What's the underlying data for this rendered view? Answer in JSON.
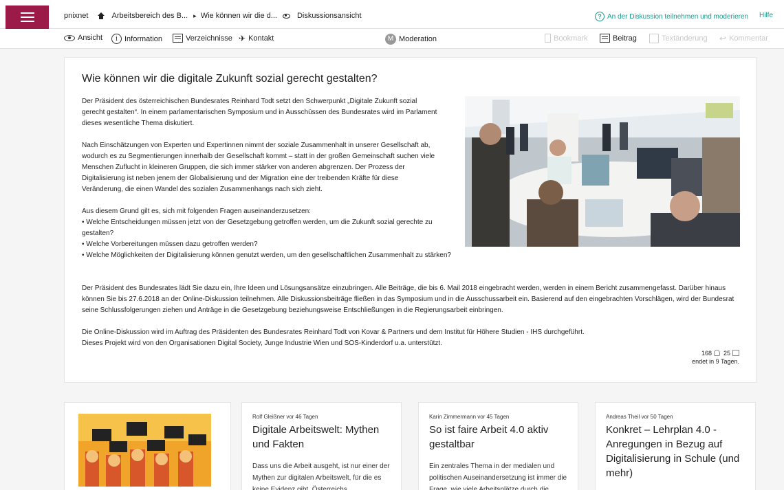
{
  "nav": {
    "site": "pnixnet",
    "crumb1": "Arbeitsbereich des B...",
    "crumb2": "Wie können wir die d...",
    "crumb3": "Diskussionsansicht",
    "join": "An der Diskussion teilnehmen und moderieren",
    "help": "Hilfe"
  },
  "toolbar": {
    "ansicht": "Ansicht",
    "information": "Information",
    "verzeichnisse": "Verzeichnisse",
    "kontakt": "Kontakt",
    "moderation": "Moderation",
    "bookmark": "Bookmark",
    "beitrag": "Beitrag",
    "textaenderung": "Textänderung",
    "kommentar": "Kommentar"
  },
  "article": {
    "title": "Wie können wir die digitale Zukunft sozial gerecht gestalten?",
    "p1": "Der Präsident des österreichischen Bundesrates Reinhard Todt setzt den Schwerpunkt „Digitale Zukunft sozial gerecht gestalten“. In einem parlamentarischen Symposium und in Ausschüssen des Bundesrates wird im Parlament dieses wesentliche Thema diskutiert.",
    "p2": "Nach Einschätzungen von Experten und Expertinnen nimmt der soziale Zusammenhalt in unserer Gesellschaft ab, wodurch es zu Segmentierungen innerhalb der Gesellschaft kommt – statt in der großen Gemeinschaft suchen viele Menschen Zuflucht in kleineren Gruppen, die sich immer stärker von anderen abgrenzen. Der Prozess der Digitalisierung ist neben jenem der Globalisierung und der Migration eine der treibenden Kräfte für diese Veränderung, die einen Wandel des sozialen Zusammenhangs nach sich zieht.",
    "p3_intro": "Aus diesem Grund gilt es, sich mit folgenden Fragen auseinanderzusetzen:",
    "q1": "• Welche Entscheidungen müssen jetzt von der Gesetzgebung getroffen werden, um die Zukunft sozial gerechte zu gestalten?",
    "q2": "• Welche Vorbereitungen müssen dazu getroffen werden?",
    "q3": "• Welche Möglichkeiten der Digitalisierung können genutzt werden, um den gesellschaftlichen Zusammenhalt zu stärken?",
    "p4": "Der Präsident des Bundesrates lädt Sie dazu ein, Ihre Ideen und Lösungsansätze einzubringen. Alle Beiträge, die bis 6. Mail 2018 eingebracht werden, werden in einem Bericht zusammengefasst. Darüber hinaus können Sie bis 27.6.2018 an der Online-Diskussion teilnehmen. Alle Diskussionsbeiträge fließen in das Symposium und in die Ausschussarbeit ein. Basierend auf den eingebrachten Vorschlägen, wird der Bundesrat seine Schlussfolgerungen ziehen und Anträge in die Gesetzgebung beziehungsweise Entschließungen in die Regierungsarbeit einbringen.",
    "p5a": "Die Online-Diskussion wird im Auftrag des Präsidenten des Bundesrates Reinhard Todt von Kovar & Partners und dem Institut für Höhere Studien - IHS durchgeführt.",
    "p5b": "Dieses Projekt wird von den Organisationen Digital Society, Junge Industrie Wien und SOS-Kinderdorf u.a. unterstützt.",
    "participants": "168",
    "posts": "25",
    "ends": "endet in 9 Tagen."
  },
  "cards": [
    {
      "meta": "Rolf Gleißner vor 46 Tagen",
      "title": "Digitale Arbeitswelt: Mythen und Fakten",
      "text": "Dass uns die Arbeit ausgeht, ist nur einer der Mythen zur digitalen Arbeitswelt, für die es keine Evidenz gibt. Österreichs"
    },
    {
      "meta": "Karin Zimmermann vor 45 Tagen",
      "title": "So ist faire Arbeit 4.0 aktiv gestaltbar",
      "text": "Ein zentrales Thema in der medialen und politischen Auseinandersetzung ist immer die Frage, wie viele Arbeitsplätze durch die"
    },
    {
      "meta": "Andreas Theil vor 50 Tagen",
      "title": "Konkret – Lehrplan 4.0 - Anregungen in Bezug auf Digitalisierung in Schule (und mehr)",
      "text": ""
    }
  ],
  "colors": {
    "brand": "#9c1a48",
    "link": "#1a9a8a"
  }
}
